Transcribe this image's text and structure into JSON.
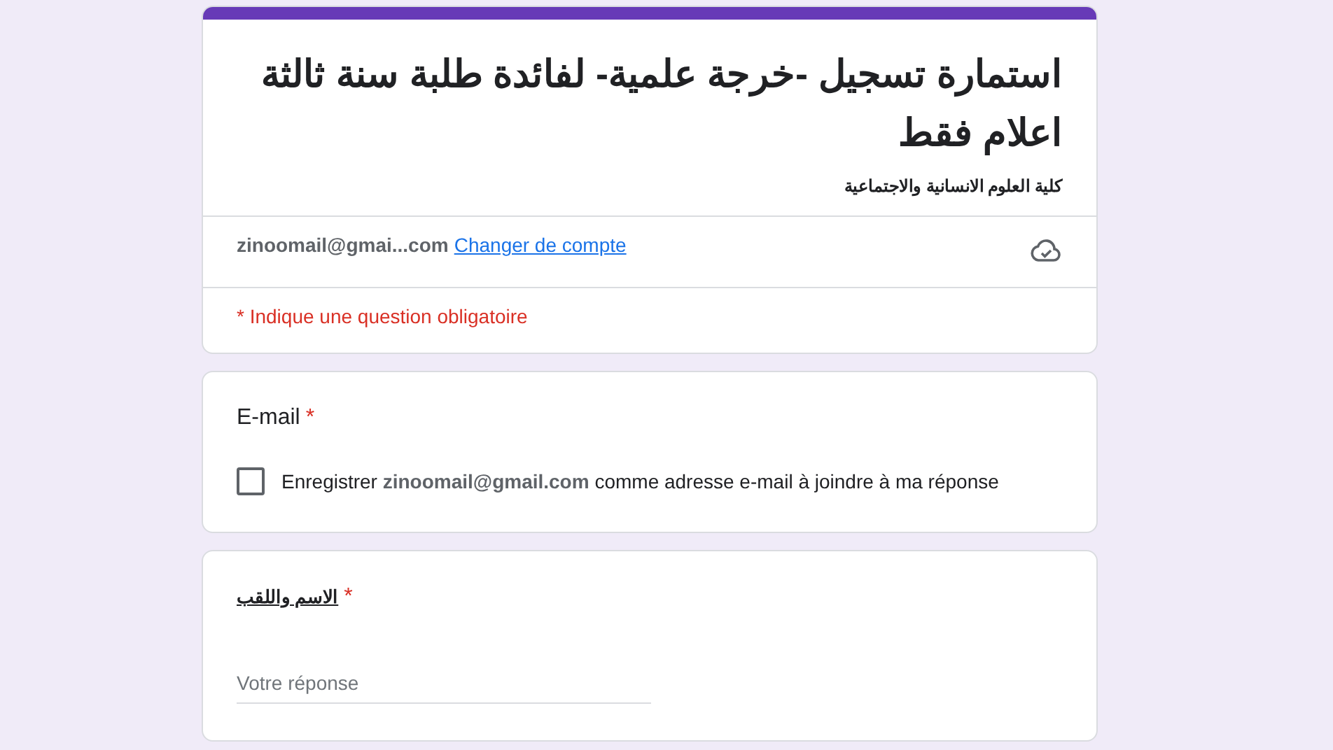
{
  "header": {
    "title": "استمارة تسجيل -خرجة علمية- لفائدة طلبة سنة ثالثة اعلام فقط",
    "description": "كلية العلوم الانسانية والاجتماعية",
    "account": "zinoomail@gmai...com",
    "switch_link": "Changer de compte",
    "required_note": "* Indique une question obligatoire"
  },
  "questions": [
    {
      "kind": "checkbox",
      "title": "E-mail",
      "required_mark": "*",
      "label": "Enregistrer **zinoomail@gmail.com** comme adresse e-mail à joindre à ma réponse",
      "checked": false
    },
    {
      "kind": "text",
      "title": "الاسم واللقب",
      "required_mark": "*",
      "placeholder": "Votre réponse"
    }
  ]
}
